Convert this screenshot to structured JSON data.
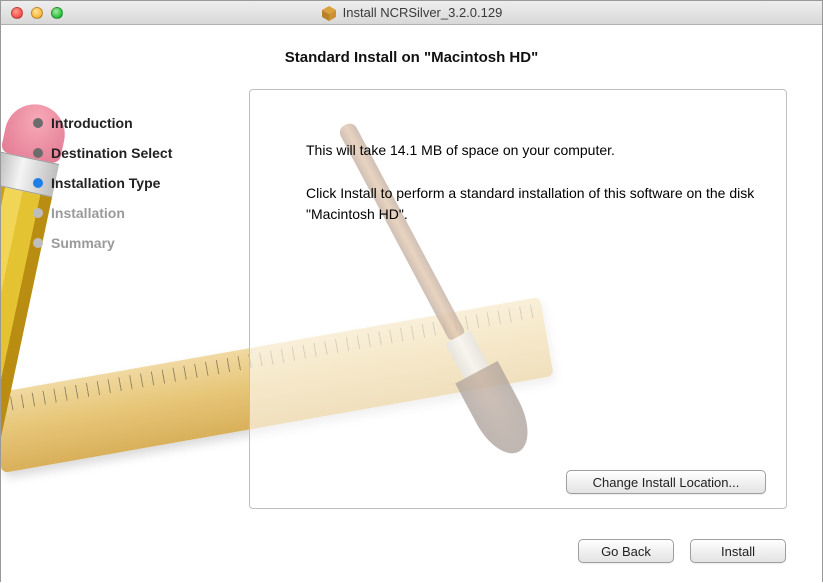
{
  "window": {
    "title": "Install NCRSilver_3.2.0.129"
  },
  "heading": "Standard Install on \"Macintosh HD\"",
  "steps": {
    "introduction": "Introduction",
    "destination": "Destination Select",
    "install_type": "Installation Type",
    "installation": "Installation",
    "summary": "Summary"
  },
  "panel": {
    "space_line": "This will take 14.1 MB of space on your computer.",
    "instructions": "Click Install to perform a standard installation of this software on the disk \"Macintosh HD\".",
    "change_location": "Change Install Location..."
  },
  "buttons": {
    "go_back": "Go Back",
    "install": "Install"
  }
}
